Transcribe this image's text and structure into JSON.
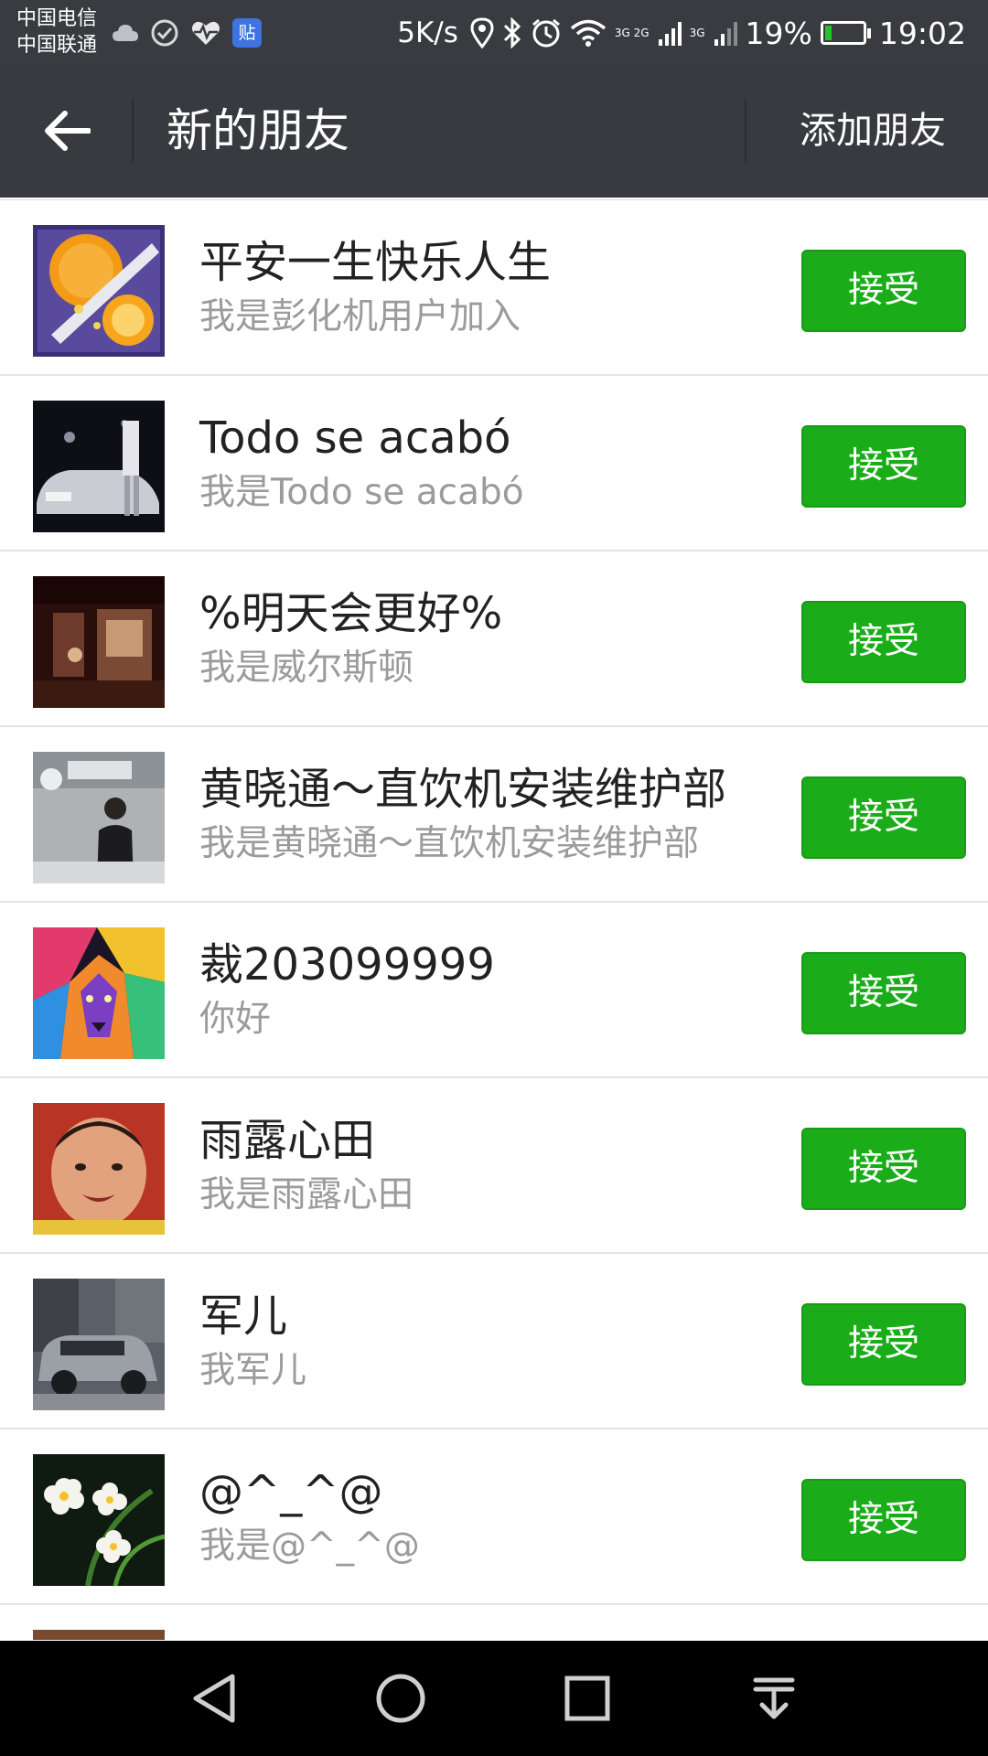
{
  "status_bar": {
    "carrier_1": "中国电信",
    "carrier_2": "中国联通",
    "tieba_badge": "贴",
    "net_speed": "5K/s",
    "network_1": "3G 2G",
    "network_2": "3G",
    "battery_percent": "19%",
    "battery_level": 0.19,
    "time": "19:02",
    "left_icons": [
      "cloud-icon",
      "check-circle-icon",
      "heart-pulse-icon",
      "tieba-icon"
    ],
    "right_icons": [
      "location-icon",
      "bluetooth-icon",
      "alarm-icon",
      "wifi-icon",
      "signal-icon",
      "signal-icon",
      "battery-charging-icon"
    ]
  },
  "header": {
    "back_icon": "arrow-left-icon",
    "title": "新的朋友",
    "add_friend": "添加朋友"
  },
  "requests": [
    {
      "nickname": "平安一生快乐人生",
      "message": "我是彭化机用户加入",
      "button": "接受",
      "avatar": "orange-avatar"
    },
    {
      "nickname": "Todo se acabó",
      "message": "我是Todo se acabó",
      "button": "接受",
      "avatar": "car-night-avatar"
    },
    {
      "nickname": "%明天会更好%",
      "message": "我是威尔斯顿",
      "button": "接受",
      "avatar": "shop-avatar"
    },
    {
      "nickname": "黄晓通～直饮机安装维护部",
      "message": "我是黄晓通～直饮机安装维护部",
      "button": "接受",
      "avatar": "man-office-avatar"
    },
    {
      "nickname": "裁203099999",
      "message": "你好",
      "button": "接受",
      "avatar": "lion-avatar"
    },
    {
      "nickname": "雨露心田",
      "message": "我是雨露心田",
      "button": "接受",
      "avatar": "baby-avatar"
    },
    {
      "nickname": "军儿",
      "message": "我军儿",
      "button": "接受",
      "avatar": "suv-avatar"
    },
    {
      "nickname": "@^_^@",
      "message": "我是@^_^@",
      "button": "接受",
      "avatar": "flowers-avatar"
    }
  ],
  "navbar": {
    "back": "nav-back-icon",
    "home": "nav-home-icon",
    "recents": "nav-recents-icon",
    "notifications": "nav-pulldown-icon"
  }
}
